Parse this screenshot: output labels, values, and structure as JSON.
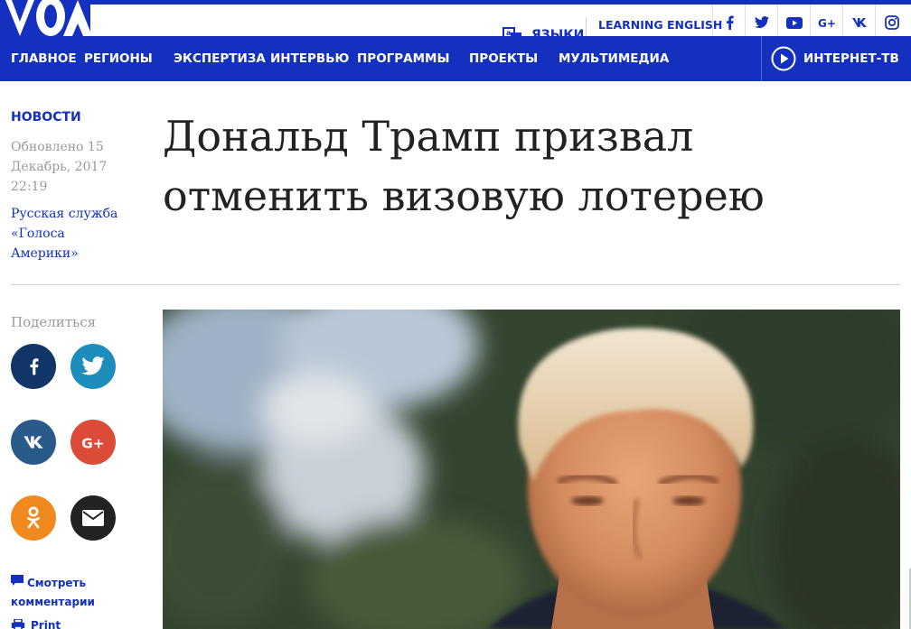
{
  "brand": {
    "logo_text": "VOA"
  },
  "topbar": {
    "languages_label": "ЯЗЫКИ",
    "learning_english": "LEARNING ENGLISH",
    "social": [
      "facebook-icon",
      "twitter-icon",
      "youtube-icon",
      "google-plus-icon",
      "vk-icon",
      "instagram-icon"
    ]
  },
  "nav": {
    "items": [
      "ГЛАВНОЕ",
      "РЕГИОНЫ",
      "ЭКСПЕРТИЗА",
      "ИНТЕРВЬЮ",
      "ПРОГРАММЫ",
      "ПРОЕКТЫ",
      "МУЛЬТИМЕДИА"
    ],
    "internet_tv": "ИНТЕРНЕТ-ТВ"
  },
  "article": {
    "section": "НОВОСТИ",
    "updated": "Обновлено 15 Декабрь, 2017 22:19",
    "author": "Русская служба «Голоса Америки»",
    "title": "Дональд Трамп призвал отменить визовую лотерею"
  },
  "share": {
    "label": "Поделиться",
    "buttons": [
      {
        "name": "facebook",
        "color": "#0f3666"
      },
      {
        "name": "twitter",
        "color": "#1d8dbc"
      },
      {
        "name": "vk",
        "color": "#2a5a8a"
      },
      {
        "name": "google-plus",
        "color": "#dc4a38"
      },
      {
        "name": "odnoklassniki",
        "color": "#f08a1e"
      },
      {
        "name": "email",
        "color": "#222222"
      }
    ]
  },
  "comments": {
    "label": "Смотреть комментарии"
  },
  "print": {
    "label": "Print"
  },
  "colors": {
    "brand_blue": "#1330bf"
  }
}
